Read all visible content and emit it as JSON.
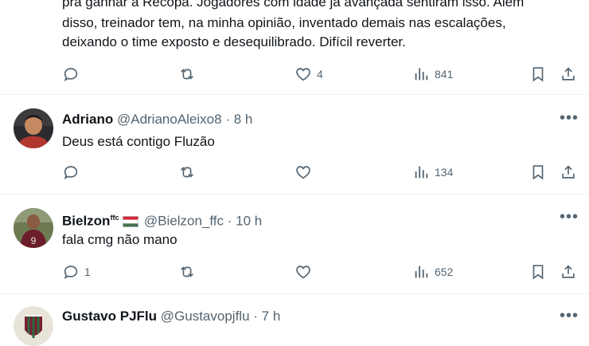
{
  "top_post": {
    "text_lines": [
      "pra ganhar a Recopa. Jogadores com idade já avançada sentiram isso. Além",
      "disso, treinador tem, na minha opinião, inventado demais nas escalações,",
      "deixando o time exposto e desequilibrado. Difícil reverter."
    ],
    "replies": "",
    "reposts": "",
    "likes": "4",
    "views": "841"
  },
  "replies": [
    {
      "name": "Adriano",
      "handle": "@AdrianoAleixo8",
      "time": "8 h",
      "text": "Deus está contigo Fluzão",
      "replies": "",
      "reposts": "",
      "likes": "",
      "views": "134"
    },
    {
      "name": "Bielzon",
      "name_suffix": "ffc",
      "flag": "hungary-flag",
      "handle": "@Bielzon_ffc",
      "time": "10 h",
      "text": "fala cmg não mano",
      "replies": "1",
      "reposts": "",
      "likes": "",
      "views": "652"
    },
    {
      "name": "Gustavo PJFlu",
      "handle": "@Gustavopjflu",
      "time": "7 h",
      "text": ""
    }
  ],
  "separator": "·",
  "colors": {
    "text": "#0f1419",
    "secondary": "#536471",
    "divider": "#eff3f4",
    "flag_red": "#ce2939",
    "flag_white": "#ffffff",
    "flag_green": "#477050"
  }
}
